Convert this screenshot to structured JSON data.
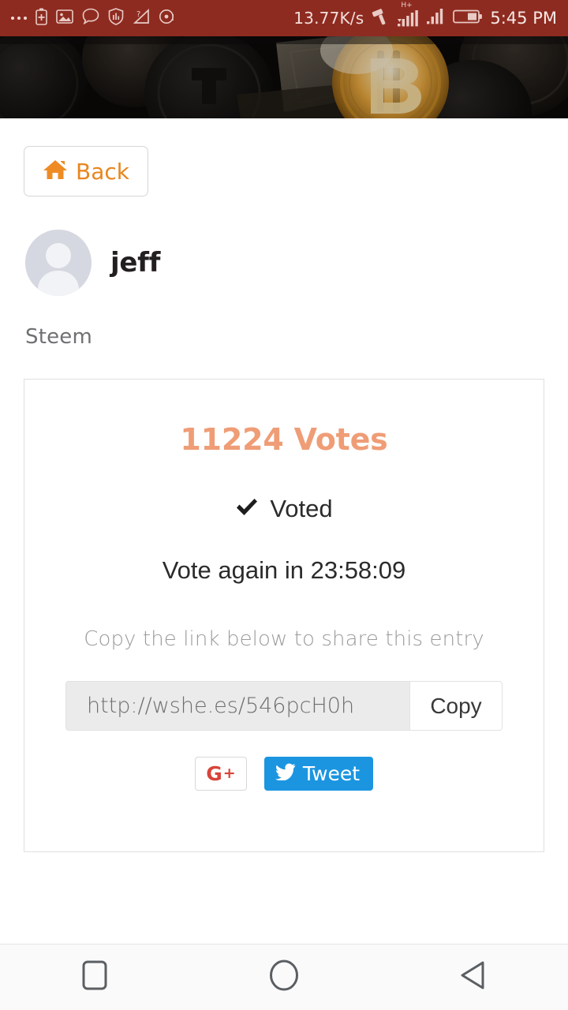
{
  "statusbar": {
    "left_icons": [
      "more-dots-icon",
      "battery-saver-icon",
      "screenshot-icon",
      "chat-bubble-icon",
      "shield-icon",
      "data-usage-icon",
      "alarm-icon"
    ],
    "network_speed": "13.77K/s",
    "gavel_icon": "gavel-icon",
    "network_type": "H+",
    "signal_icons": [
      "signal-bars-1-icon",
      "signal-bars-2-icon"
    ],
    "battery_icon": "battery-icon",
    "time": "5:45 PM",
    "bg_color": "#8e2b20"
  },
  "banner": {
    "name": "crypto-coins-banner",
    "alt": "Cryptocurrency coins banner with gold Bitcoin"
  },
  "nav": {
    "back_label": "Back",
    "back_icon": "home-icon",
    "accent_color": "#e8861f"
  },
  "profile": {
    "username": "jeff",
    "avatar": "default-avatar",
    "platform": "Steem"
  },
  "card": {
    "votes_text": "11224 Votes",
    "votes_count": 11224,
    "votes_color": "#ef9d76",
    "voted_label": "Voted",
    "voted_icon": "check-icon",
    "vote_again_text": "Vote again in 23:58:09",
    "countdown": "23:58:09",
    "share_hint": "Copy the link below to share this entry",
    "share_url": "http://wshe.es/546pcH0h",
    "copy_label": "Copy",
    "gplus_g": "G",
    "gplus_plus": "+",
    "tweet_label": "Tweet",
    "tweet_color": "#1b95e0"
  },
  "systemnav": {
    "recents": "recents-square-icon",
    "home": "home-circle-icon",
    "back": "back-triangle-icon"
  }
}
